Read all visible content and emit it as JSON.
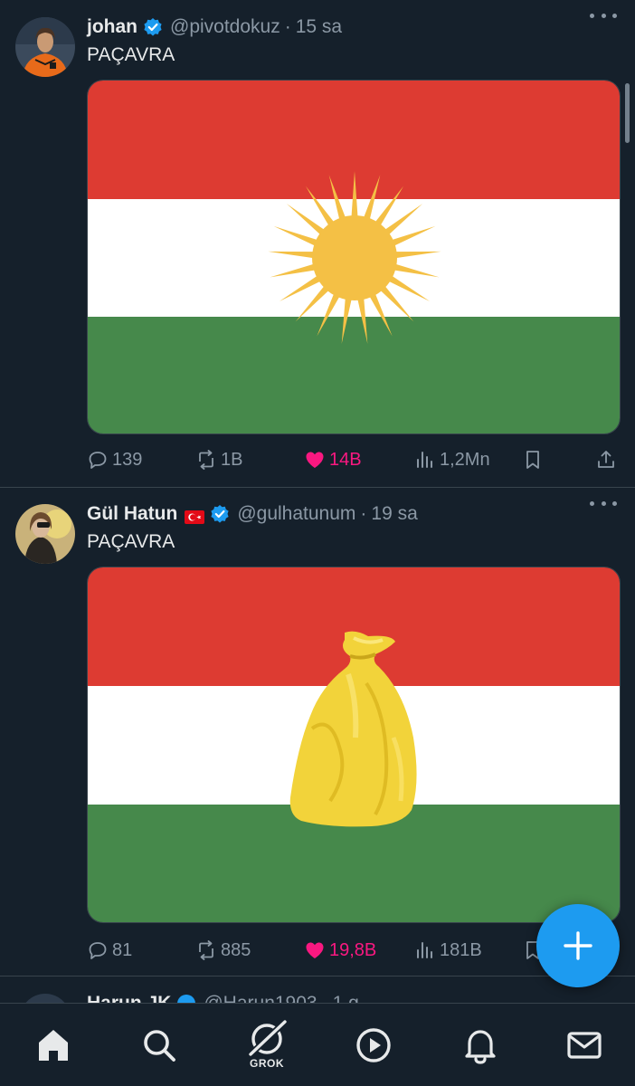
{
  "colors": {
    "background": "#15202b",
    "text": "#e7e9ea",
    "muted": "#8b98a5",
    "accent": "#1d9bf0",
    "like": "#f91880",
    "flag_red": "#dd3b32",
    "flag_white": "#ffffff",
    "flag_green": "#46894b",
    "sun_yellow": "#f4c045"
  },
  "tweets": [
    {
      "display_name": "johan",
      "verified": true,
      "handle": "@pivotdokuz",
      "separator": "·",
      "time": "15 sa",
      "text": "PAÇAVRA",
      "media_icon": "kurdistan-flag-sun",
      "stats": {
        "replies": "139",
        "retweets": "1B",
        "likes": "14B",
        "views": "1,2Mn"
      }
    },
    {
      "display_name": "Gül Hatun",
      "flag_icon": "turkey-flag-icon",
      "verified": true,
      "handle": "@gulhatunum",
      "separator": "·",
      "time": "19 sa",
      "text": "PAÇAVRA",
      "media_icon": "flag-with-yellow-trash-bag",
      "stats": {
        "replies": "81",
        "retweets": "885",
        "likes": "19,8B",
        "views": "181B"
      }
    }
  ],
  "peek_tweet": {
    "display_name": "Harun JK",
    "handle": "@Harun1903",
    "separator": "·",
    "time": "1 g"
  },
  "tabbar": {
    "grok_label": "GROK",
    "icons": [
      "home-icon",
      "search-icon",
      "grok-icon",
      "video-icon",
      "notifications-icon",
      "messages-icon"
    ]
  }
}
